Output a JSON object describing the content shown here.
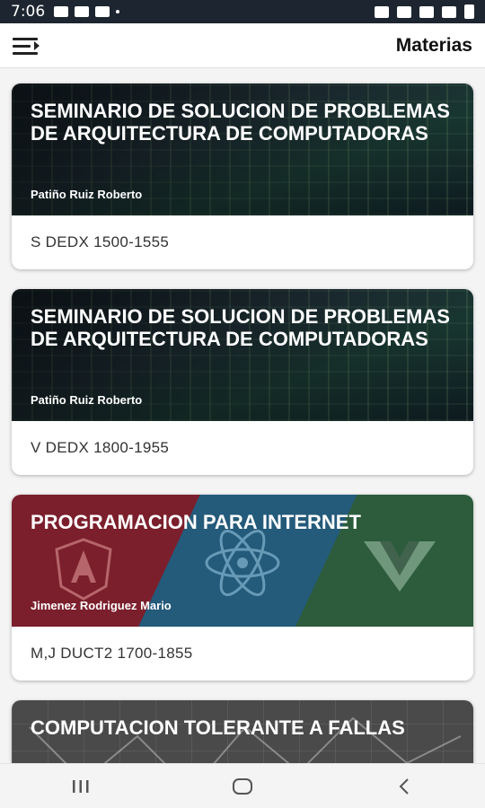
{
  "status_bar": {
    "time": "7:06"
  },
  "app_bar": {
    "title": "Materias"
  },
  "courses": [
    {
      "title": "SEMINARIO DE SOLUCION DE PROBLEMAS DE ARQUITECTURA DE COMPUTADORAS",
      "professor": "Patiño Ruiz Roberto",
      "schedule": "S DEDX 1500-1555"
    },
    {
      "title": "SEMINARIO DE SOLUCION DE PROBLEMAS DE ARQUITECTURA DE COMPUTADORAS",
      "professor": "Patiño Ruiz Roberto",
      "schedule": "V DEDX 1800-1955"
    },
    {
      "title": "PROGRAMACION PARA INTERNET",
      "professor": "Jimenez Rodriguez Mario",
      "schedule": "M,J DUCT2 1700-1855"
    },
    {
      "title": "COMPUTACION TOLERANTE A FALLAS"
    }
  ],
  "colors": {
    "accent": "#7b1f2c"
  }
}
